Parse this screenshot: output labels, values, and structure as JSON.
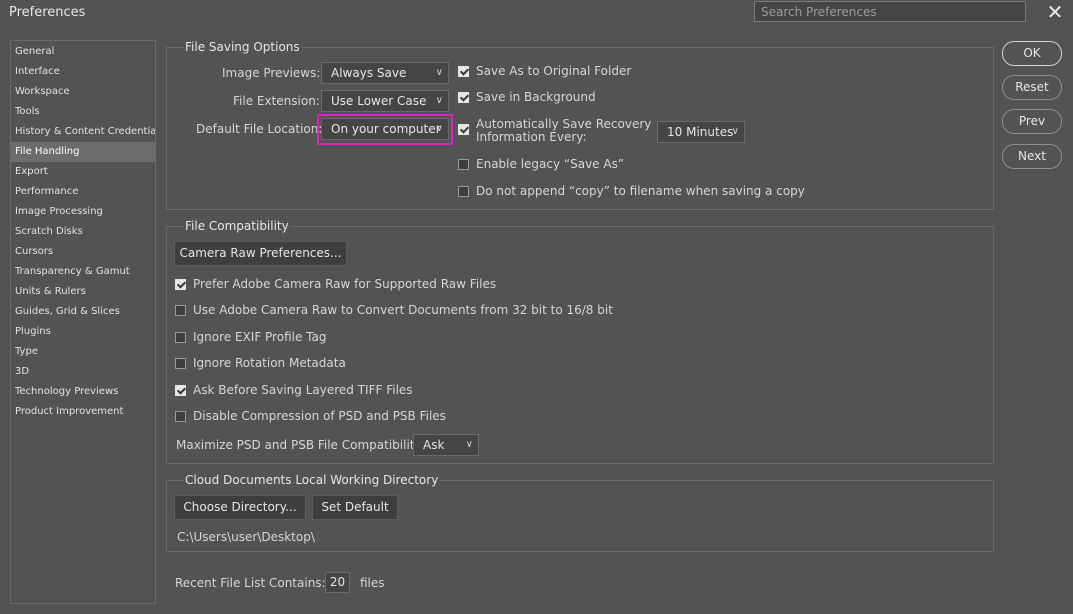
{
  "window": {
    "title": "Preferences",
    "search_placeholder": "Search Preferences"
  },
  "sidebar": {
    "items": [
      {
        "label": "General"
      },
      {
        "label": "Interface"
      },
      {
        "label": "Workspace"
      },
      {
        "label": "Tools"
      },
      {
        "label": "History & Content Credentials"
      },
      {
        "label": "File Handling",
        "selected": true
      },
      {
        "label": "Export"
      },
      {
        "label": "Performance"
      },
      {
        "label": "Image Processing"
      },
      {
        "label": "Scratch Disks"
      },
      {
        "label": "Cursors"
      },
      {
        "label": "Transparency & Gamut"
      },
      {
        "label": "Units & Rulers"
      },
      {
        "label": "Guides, Grid & Slices"
      },
      {
        "label": "Plugins"
      },
      {
        "label": "Type"
      },
      {
        "label": "3D"
      },
      {
        "label": "Technology Previews"
      },
      {
        "label": "Product Improvement"
      }
    ]
  },
  "file_saving": {
    "title": "File Saving Options",
    "image_previews_label": "Image Previews:",
    "image_previews_value": "Always Save",
    "file_extension_label": "File Extension:",
    "file_extension_value": "Use Lower Case",
    "default_location_label": "Default File Location:",
    "default_location_value": "On your computer",
    "save_as_original": {
      "label": "Save As to Original Folder",
      "checked": true
    },
    "save_background": {
      "label": "Save in Background",
      "checked": true
    },
    "auto_save_line1": "Automatically Save Recovery",
    "auto_save_line2": "Information Every:",
    "auto_save_checked": true,
    "auto_save_interval": "10 Minutes",
    "legacy_save_as": {
      "label": "Enable legacy “Save As”",
      "checked": false
    },
    "no_copy": {
      "label": "Do not append “copy” to filename when saving a copy",
      "checked": false
    }
  },
  "file_compat": {
    "title": "File Compatibility",
    "camera_raw_button": "Camera Raw Preferences...",
    "options": [
      {
        "label": "Prefer Adobe Camera Raw for Supported Raw Files",
        "checked": true
      },
      {
        "label": "Use Adobe Camera Raw to Convert Documents from 32 bit to 16/8 bit",
        "checked": false
      },
      {
        "label": "Ignore EXIF Profile Tag",
        "checked": false
      },
      {
        "label": "Ignore Rotation Metadata",
        "checked": false
      },
      {
        "label": "Ask Before Saving Layered TIFF Files",
        "checked": true
      },
      {
        "label": "Disable Compression of PSD and PSB Files",
        "checked": false
      }
    ],
    "maximize_label": "Maximize PSD and PSB File Compatibility:",
    "maximize_value": "Ask"
  },
  "cloud": {
    "title": "Cloud Documents Local Working Directory",
    "choose_button": "Choose Directory...",
    "default_button": "Set Default",
    "path": "C:\\Users\\user\\Desktop\\"
  },
  "recent": {
    "label": "Recent File List Contains:",
    "value": "20",
    "suffix": "files"
  },
  "buttons": {
    "ok": "OK",
    "reset": "Reset",
    "prev": "Prev",
    "next": "Next"
  },
  "colors": {
    "background": "#535353",
    "highlight": "#d425c8",
    "text": "#dcdcdc"
  }
}
